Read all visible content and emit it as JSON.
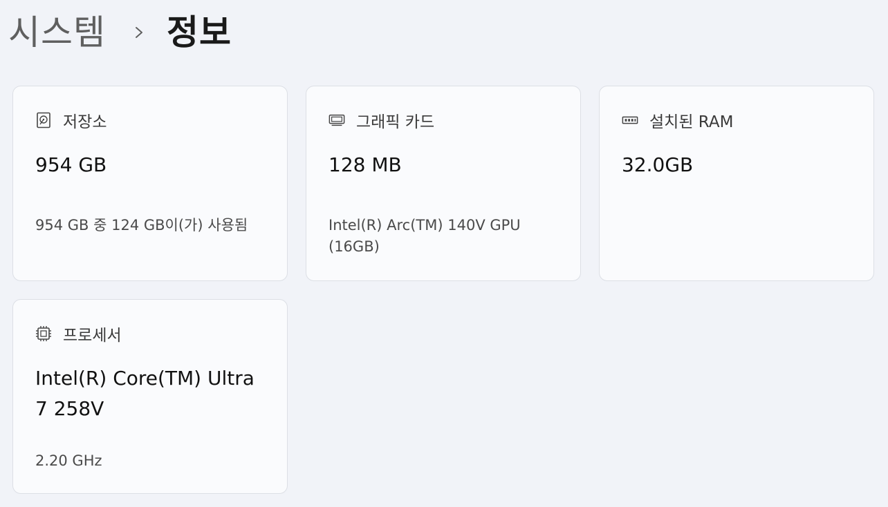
{
  "breadcrumb": {
    "parent": "시스템",
    "separator_icon": "chevron-right-icon",
    "current": "정보"
  },
  "cards": {
    "storage": {
      "icon": "hard-drive-icon",
      "title": "저장소",
      "value": "954 GB",
      "subtitle": "954 GB 중 124 GB이(가) 사용됨"
    },
    "graphics": {
      "icon": "graphics-card-icon",
      "title": "그래픽 카드",
      "value": "128 MB",
      "subtitle": "Intel(R) Arc(TM) 140V GPU (16GB)"
    },
    "ram": {
      "icon": "memory-icon",
      "title": "설치된 RAM",
      "value": "32.0GB"
    },
    "processor": {
      "icon": "processor-chip-icon",
      "title": "프로세서",
      "value": "Intel(R) Core(TM) Ultra 7 258V",
      "subtitle": "2.20 GHz"
    }
  }
}
